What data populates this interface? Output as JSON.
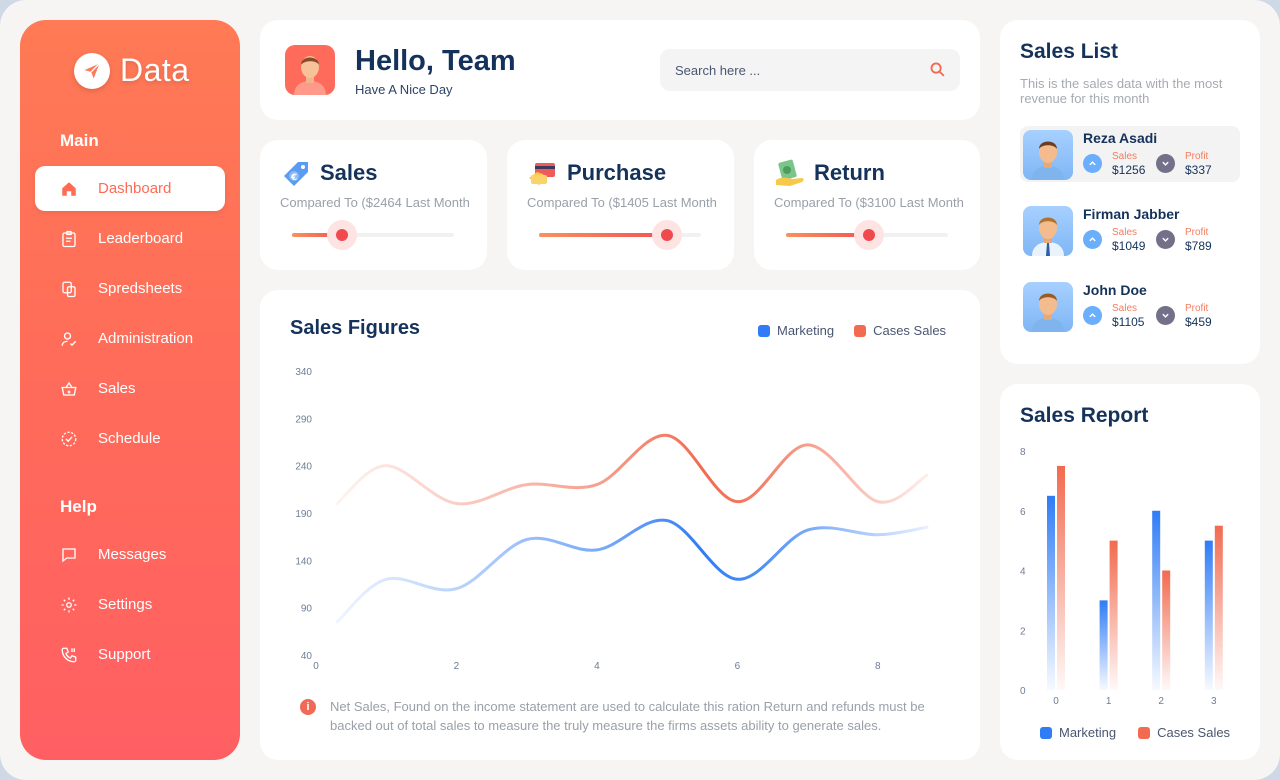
{
  "brand": {
    "name": "Data",
    "logo_icon": "paper-plane-icon"
  },
  "sidebar": {
    "main_title": "Main",
    "main_items": [
      {
        "label": "Dashboard",
        "icon": "home-icon",
        "active": true
      },
      {
        "label": "Leaderboard",
        "icon": "clipboard-icon"
      },
      {
        "label": "Spredsheets",
        "icon": "copy-icon"
      },
      {
        "label": "Administration",
        "icon": "user-check-icon"
      },
      {
        "label": "Sales",
        "icon": "basket-icon"
      },
      {
        "label": "Schedule",
        "icon": "check-circle-icon"
      }
    ],
    "help_title": "Help",
    "help_items": [
      {
        "label": "Messages",
        "icon": "message-icon"
      },
      {
        "label": "Settings",
        "icon": "gear-icon"
      },
      {
        "label": "Support",
        "icon": "phone-icon"
      }
    ]
  },
  "header": {
    "greeting": "Hello, Team",
    "subtitle": "Have A Nice Day",
    "search_placeholder": "Search here ..."
  },
  "stats": [
    {
      "title": "Sales",
      "subtitle": "Compared To ($2464 Last Month",
      "icon": "euro-tag-icon",
      "progress": 0.31
    },
    {
      "title": "Purchase",
      "subtitle": "Compared To ($1405 Last Month",
      "icon": "credit-card-icon",
      "progress": 0.79
    },
    {
      "title": "Return",
      "subtitle": "Compared To ($3100 Last Month",
      "icon": "money-hand-icon",
      "progress": 0.51
    }
  ],
  "sales_figures": {
    "title": "Sales Figures",
    "legend": [
      "Marketing",
      "Cases Sales"
    ],
    "note": "Net Sales, Found on the income statement are used to calculate this ration Return and refunds must be backed out of total sales to measure the truly measure the firms assets ability to generate sales."
  },
  "sales_list": {
    "title": "Sales List",
    "description": "This is the sales data with the most revenue for this month",
    "people": [
      {
        "name": "Reza Asadi",
        "sales_label": "Sales",
        "sales": "$1256",
        "profit_label": "Profit",
        "profit": "$337"
      },
      {
        "name": "Firman Jabber",
        "sales_label": "Sales",
        "sales": "$1049",
        "profit_label": "Profit",
        "profit": "$789"
      },
      {
        "name": "John Doe",
        "sales_label": "Sales",
        "sales": "$1105",
        "profit_label": "Profit",
        "profit": "$459"
      }
    ]
  },
  "sales_report": {
    "title": "Sales Report",
    "legend": [
      "Marketing",
      "Cases Sales"
    ]
  },
  "colors": {
    "accent": "#ff6b5a",
    "marketing": "#2f7cf6",
    "cases": "#f26a4f",
    "navy": "#15325a"
  },
  "chart_data": [
    {
      "type": "line",
      "title": "Sales Figures",
      "ylim": [
        40,
        340
      ],
      "xlim": [
        0,
        8.9
      ],
      "yticks": [
        340,
        290,
        240,
        190,
        140,
        90,
        40
      ],
      "xticks": [
        0,
        2,
        4,
        6,
        8
      ],
      "series": [
        {
          "name": "Marketing",
          "x": [
            0.3,
            1,
            2,
            3,
            4,
            5,
            6,
            7,
            8,
            8.7
          ],
          "values": [
            75,
            120,
            110,
            162,
            151,
            182,
            120,
            172,
            167,
            175
          ]
        },
        {
          "name": "Cases Sales",
          "x": [
            0.3,
            1,
            2,
            3,
            4,
            5,
            6,
            7,
            8,
            8.7
          ],
          "values": [
            200,
            240,
            200,
            220,
            220,
            272,
            202,
            262,
            202,
            230
          ]
        }
      ]
    },
    {
      "type": "bar",
      "title": "Sales Report",
      "categories": [
        "0",
        "1",
        "2",
        "3"
      ],
      "ylim": [
        0,
        8
      ],
      "yticks": [
        8,
        6,
        4,
        2,
        0
      ],
      "series": [
        {
          "name": "Marketing",
          "values": [
            6.5,
            3,
            6,
            5
          ]
        },
        {
          "name": "Cases Sales",
          "values": [
            7.5,
            5,
            4,
            5.5
          ]
        }
      ]
    }
  ]
}
